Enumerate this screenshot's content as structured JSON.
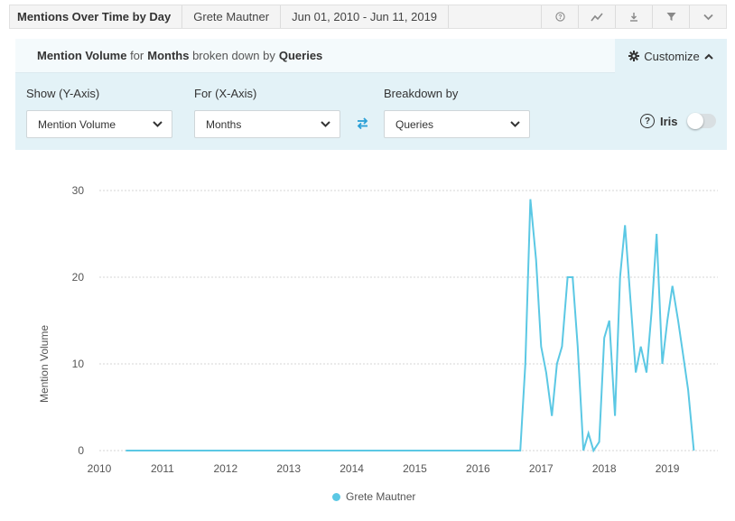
{
  "header": {
    "title": "Mentions Over Time by Day",
    "user": "Grete Mautner",
    "date_range": "Jun 01, 2010 - Jun 11, 2019",
    "icons": [
      "help-icon",
      "line-chart-icon",
      "download-icon",
      "filter-icon",
      "chevron-down-icon"
    ]
  },
  "panel": {
    "metric": "Mention Volume",
    "for_word": "for",
    "interval": "Months",
    "breakdown_word": "broken down by",
    "breakdown": "Queries",
    "customize_label": "Customize",
    "y_axis_label": "Show (Y-Axis)",
    "y_axis_value": "Mention Volume",
    "x_axis_label": "For (X-Axis)",
    "x_axis_value": "Months",
    "breakdown_label": "Breakdown by",
    "breakdown_value": "Queries",
    "iris_label": "Iris",
    "iris_enabled": false
  },
  "colors": {
    "accent": "#5bc8e4",
    "panel": "#e3f2f7",
    "swap": "#2a9fd6"
  },
  "chart_data": {
    "type": "line",
    "title": "",
    "xlabel": "",
    "ylabel": "Mention Volume",
    "xlim": [
      2010.0,
      2019.8
    ],
    "ylim": [
      0,
      30
    ],
    "yticks": [
      0,
      10,
      20,
      30
    ],
    "xticks": [
      2010,
      2011,
      2012,
      2013,
      2014,
      2015,
      2016,
      2017,
      2018,
      2019
    ],
    "grid": true,
    "legend": "bottom",
    "series": [
      {
        "name": "Grete Mautner",
        "color": "#5bc8e4",
        "x": [
          2010.42,
          2016.67,
          2016.75,
          2016.83,
          2016.92,
          2017.0,
          2017.08,
          2017.17,
          2017.25,
          2017.33,
          2017.42,
          2017.5,
          2017.58,
          2017.67,
          2017.75,
          2017.83,
          2017.92,
          2018.0,
          2018.08,
          2018.17,
          2018.25,
          2018.33,
          2018.42,
          2018.5,
          2018.58,
          2018.67,
          2018.75,
          2018.83,
          2018.92,
          2019.0,
          2019.08,
          2019.17,
          2019.25,
          2019.33,
          2019.42
        ],
        "y": [
          0,
          0,
          10,
          29,
          22,
          12,
          9,
          4,
          10,
          12,
          20,
          20,
          12,
          0,
          2,
          0,
          1,
          13,
          15,
          4,
          20,
          26,
          17,
          9,
          12,
          9,
          16,
          25,
          10,
          15,
          19,
          15,
          11,
          7,
          0
        ]
      }
    ]
  }
}
